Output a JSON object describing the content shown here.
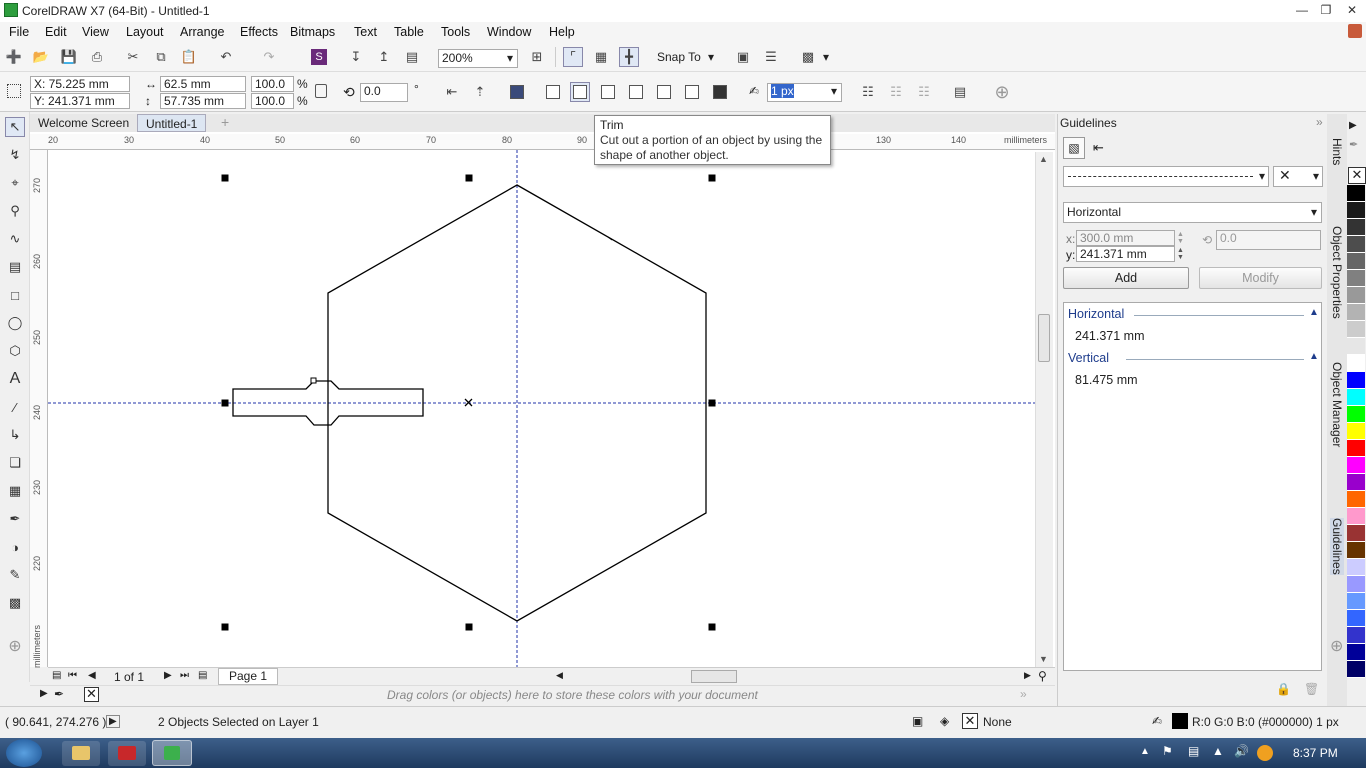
{
  "window": {
    "title": "CorelDRAW X7 (64-Bit) - Untitled-1"
  },
  "menu": [
    "File",
    "Edit",
    "View",
    "Layout",
    "Arrange",
    "Effects",
    "Bitmaps",
    "Text",
    "Table",
    "Tools",
    "Window",
    "Help"
  ],
  "toolbar": {
    "zoom": "200%",
    "snap_to": "Snap To"
  },
  "property_bar": {
    "x": "X: 75.225 mm",
    "y": "Y: 241.371 mm",
    "width": "62.5 mm",
    "height": "57.735 mm",
    "scale_x": "100.0",
    "scale_y": "100.0",
    "percent": "%",
    "rotation": "0.0",
    "degree": "°",
    "outline_width": "1 px"
  },
  "doc_tabs": [
    "Welcome Screen",
    "Untitled-1"
  ],
  "ruler": {
    "h_ticks": [
      "20",
      "30",
      "40",
      "50",
      "60",
      "70",
      "80",
      "90",
      "130",
      "140"
    ],
    "h_unit": "millimeters",
    "v_ticks": [
      "270",
      "260",
      "250",
      "240",
      "230",
      "220"
    ],
    "v_unit": "millimeters"
  },
  "tooltip": {
    "title": "Trim",
    "desc": "Cut out a portion of an object by using the shape of another object."
  },
  "page_nav": {
    "count": "1 of 1",
    "page": "Page 1"
  },
  "color_dock_hint": "Drag colors (or objects) here to store these colors with your document",
  "status": {
    "coords": "( 90.641, 274.276 )",
    "selection": "2 Objects Selected on Layer 1",
    "fill": "None",
    "outline": "R:0 G:0 B:0 (#000000)  1 px"
  },
  "docker": {
    "title": "Guidelines",
    "orientation": "Horizontal",
    "x_label": "x:",
    "x_value": "300.0 mm",
    "y_label": "y:",
    "y_value": "241.371 mm",
    "angle": "0.0",
    "add": "Add",
    "modify": "Modify",
    "sections": [
      {
        "name": "Horizontal",
        "values": [
          "241.371 mm"
        ]
      },
      {
        "name": "Vertical",
        "values": [
          "81.475 mm"
        ]
      }
    ]
  },
  "side_tabs": [
    "Hints",
    "Object Properties",
    "Object Manager",
    "Guidelines"
  ],
  "palette": [
    "#000000",
    "#1a1a1a",
    "#333333",
    "#4d4d4d",
    "#666666",
    "#808080",
    "#999999",
    "#b3b3b3",
    "#cccccc",
    "#e6e6e6",
    "#ffffff",
    "#0000ff",
    "#00ffff",
    "#00ff00",
    "#ffff00",
    "#ff0000",
    "#ff00ff",
    "#9900cc",
    "#ff6600",
    "#ff99cc",
    "#993333",
    "#663300",
    "#ccccff",
    "#9999ff",
    "#6699ff",
    "#3366ff",
    "#3333cc",
    "#000099",
    "#000066"
  ],
  "taskbar": {
    "time": "8:37 PM"
  }
}
